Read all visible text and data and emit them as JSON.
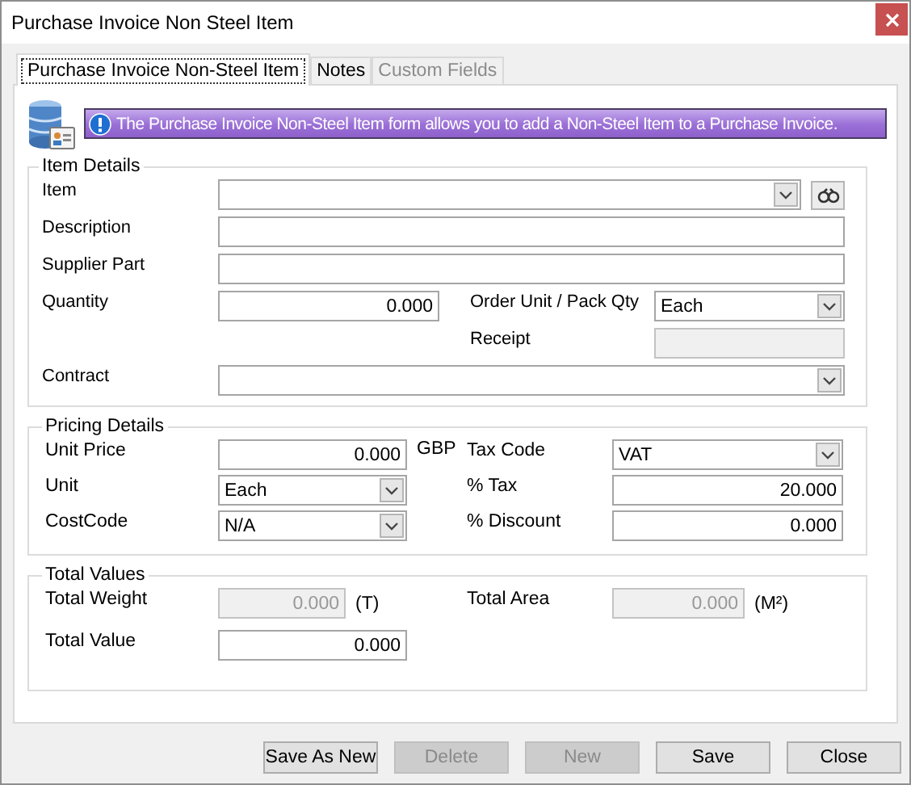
{
  "window": {
    "title": "Purchase Invoice Non Steel Item"
  },
  "tabs": [
    {
      "label": "Purchase Invoice Non-Steel Item",
      "selected": true,
      "disabled": false
    },
    {
      "label": "Notes",
      "selected": false,
      "disabled": false
    },
    {
      "label": "Custom Fields",
      "selected": false,
      "disabled": true
    }
  ],
  "info_banner": {
    "text": "The Purchase Invoice Non-Steel Item form allows you to add a Non-Steel Item to a Purchase Invoice."
  },
  "item_details": {
    "title": "Item Details",
    "item": {
      "label": "Item"
    },
    "description": {
      "label": "Description"
    },
    "supplier_part": {
      "label": "Supplier Part"
    },
    "quantity": {
      "label": "Quantity",
      "value": "0.000"
    },
    "order_unit": {
      "label": "Order Unit / Pack Qty",
      "value": "Each"
    },
    "receipt": {
      "label": "Receipt",
      "disabled": true
    },
    "contract": {
      "label": "Contract"
    }
  },
  "pricing_details": {
    "title": "Pricing Details",
    "unit_price": {
      "label": "Unit Price",
      "value": "0.000",
      "unit": "GBP"
    },
    "tax_code": {
      "label": "Tax Code",
      "value": "VAT"
    },
    "unit": {
      "label": "Unit",
      "value": "Each"
    },
    "tax": {
      "label": "% Tax",
      "value": "20.000"
    },
    "cost_code": {
      "label": "CostCode",
      "value": "N/A"
    },
    "discount": {
      "label": "% Discount",
      "value": "0.000"
    }
  },
  "total_values": {
    "title": "Total Values",
    "total_weight": {
      "label": "Total Weight",
      "value": "0.000",
      "unit": "(T)",
      "disabled": true
    },
    "total_area": {
      "label": "Total Area",
      "value": "0.000",
      "unit": "(M²)",
      "disabled": true
    },
    "total_value": {
      "label": "Total Value",
      "value": "0.000",
      "disabled": false
    }
  },
  "buttons": [
    {
      "label": "Save As New",
      "disabled": false
    },
    {
      "label": "Delete",
      "disabled": true
    },
    {
      "label": "New",
      "disabled": true
    },
    {
      "label": "Save",
      "disabled": false
    },
    {
      "label": "Close",
      "disabled": false
    }
  ]
}
